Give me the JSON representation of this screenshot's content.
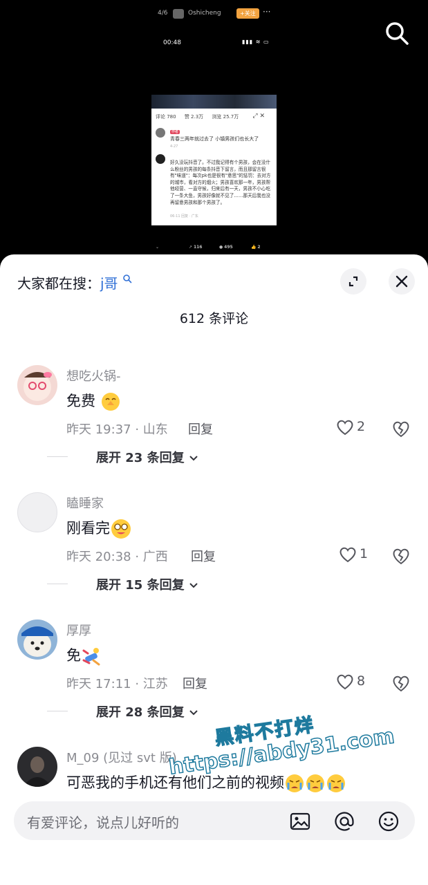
{
  "video": {
    "phone": {
      "index": "4/6",
      "username": "Oshicheng",
      "follow_label": "+关注",
      "time": "00:48",
      "card": {
        "tab_comments": "评论 780",
        "tab_likes": "赞 2.3万",
        "tab_views": "浏览 25.7万",
        "c1_tag": "作者",
        "c1_text": "青春三两年就过去了 小镇男孩们也长大了",
        "c1_date": "4-27",
        "c2_text": "好久没玩抖音了。不过我记得有个男孩，会在没什么粉丝的男孩的每条抖音下留言，而且那留言很有\"味道\"：每次pk也是很有\"意思\"的惩罚：去对方的城市，看对方的烟火；男孩喜欢那一年，男孩帮他经营、一直守候，归来后有一天，男孩不小心吃了一条大鱼，男孩好像就不见了……那天后我也没再留意男孩和那个男孩了。",
        "c2_foot": "06-11 回复 · 广东"
      },
      "bottom": {
        "shares": "116",
        "comments": "495",
        "likes": "2"
      }
    }
  },
  "sheet": {
    "search_prefix": "大家都在搜：",
    "search_keyword": "j哥",
    "comment_count": "612 条评论",
    "comments": [
      {
        "username": "想吃火锅-",
        "text": "免费",
        "meta": "昨天 19:37 · 山东",
        "reply": "回复",
        "likes": "2",
        "expand": "展开 23 条回复"
      },
      {
        "username": "瞌睡家",
        "text": "刚看完",
        "meta": "昨天 20:38 · 广西",
        "reply": "回复",
        "likes": "1",
        "expand": "展开 15 条回复"
      },
      {
        "username": "厚厚",
        "text": "免",
        "meta": "昨天 17:11 · 江苏",
        "reply": "回复",
        "likes": "8",
        "expand": "展开 28 条回复"
      },
      {
        "username": "M_09 (见过 svt 版)",
        "text": "可恶我的手机还有他们之前的视频"
      }
    ],
    "input_placeholder": "有爱评论，说点儿好听的"
  },
  "watermark": {
    "line1": "黑料不打烊",
    "line2": "https://abdy31.com"
  },
  "icons": [
    "search-icon",
    "expand-icon",
    "close-icon",
    "heart-icon",
    "broken-heart-icon",
    "chevron-down-icon",
    "image-icon",
    "at-icon",
    "emoji-icon"
  ],
  "colors": {
    "accent_link": "#2f6fd6",
    "text_primary": "#161823",
    "text_secondary": "#8a8b91",
    "follow": "#f2a340"
  }
}
